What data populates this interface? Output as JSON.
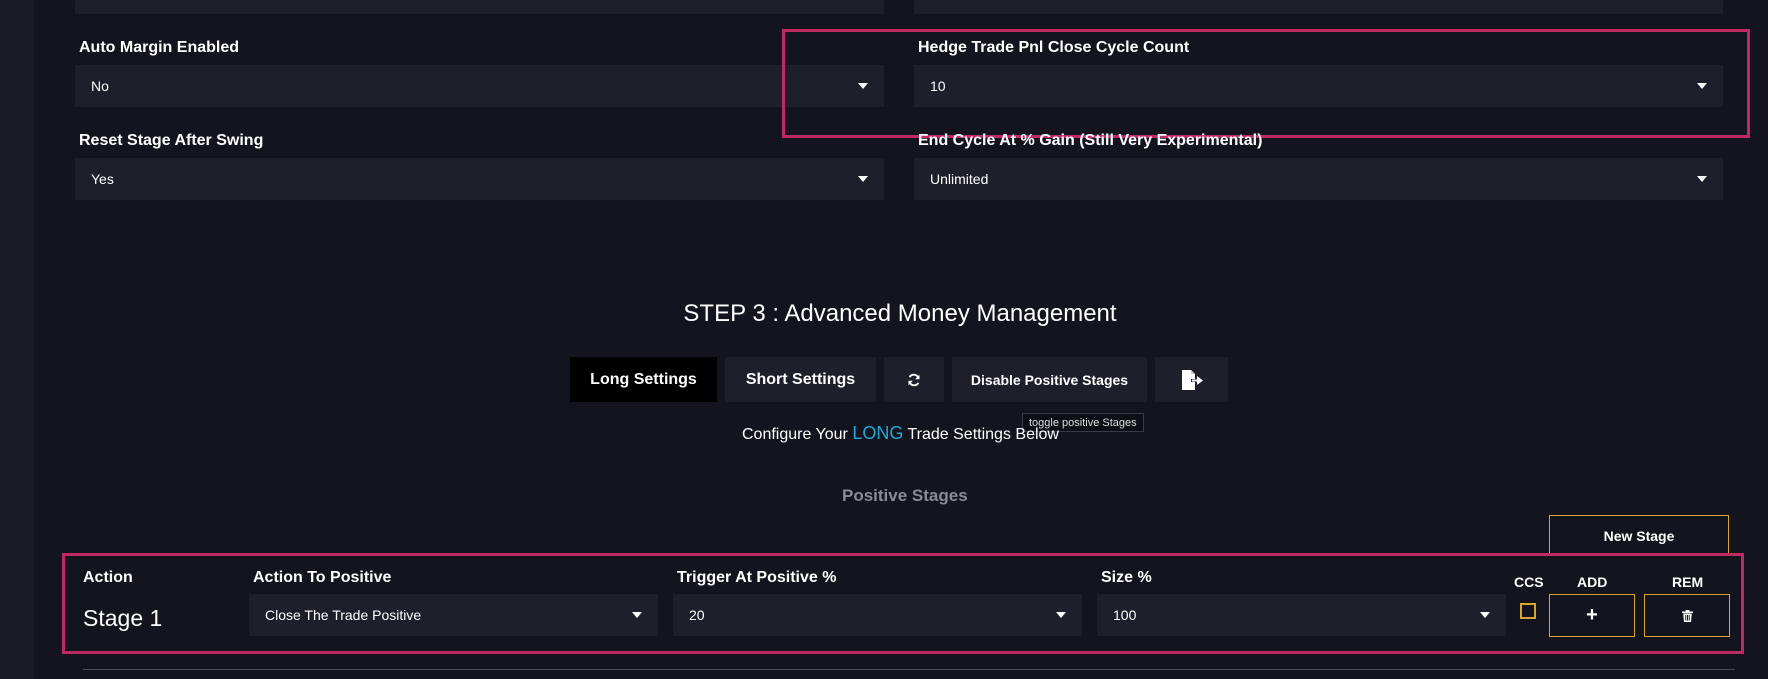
{
  "settings": {
    "auto_margin": {
      "label": "Auto Margin Enabled",
      "value": "No"
    },
    "hedge_cycle": {
      "label": "Hedge Trade Pnl Close Cycle Count",
      "value": "10"
    },
    "reset_stage": {
      "label": "Reset Stage After Swing",
      "value": "Yes"
    },
    "end_cycle": {
      "label": "End Cycle At % Gain (Still Very Experimental)",
      "value": "Unlimited"
    }
  },
  "step3": {
    "title": "STEP 3 : Advanced Money Management",
    "buttons": {
      "long": "Long Settings",
      "short": "Short Settings",
      "disable_positive": "Disable Positive Stages"
    },
    "tooltip": "toggle positive Stages",
    "configure": {
      "prefix": "Configure Your",
      "mode": "LONG",
      "suffix": "Trade Settings Below"
    },
    "positive_stages_title": "Positive Stages",
    "new_stage": "New Stage"
  },
  "stage_row": {
    "headers": {
      "action": "Action",
      "action_to_positive": "Action To Positive",
      "trigger": "Trigger At Positive %",
      "size": "Size %",
      "ccs": "CCS",
      "add": "ADD",
      "rem": "REM"
    },
    "stage_name": "Stage 1",
    "action_to_positive": "Close The Trade Positive",
    "trigger": "20",
    "size": "100",
    "ccs_checked": false,
    "add_symbol": "+"
  },
  "icons": {
    "refresh": "refresh-icon",
    "export": "export-icon",
    "trash": "trash-icon"
  },
  "colors": {
    "background": "#13141d",
    "field": "#1e1f2a",
    "highlight": "#c02a62",
    "accent_outline": "#d8a531",
    "long_accent": "#25a8d6"
  }
}
